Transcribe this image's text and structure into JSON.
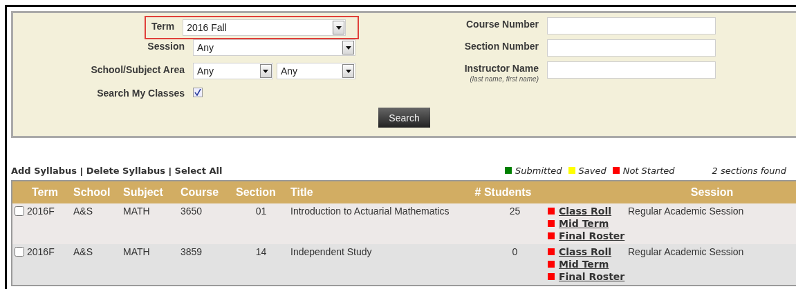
{
  "filters": {
    "term": {
      "label": "Term",
      "value": "2016 Fall",
      "highlighted": true
    },
    "session": {
      "label": "Session",
      "value": "Any"
    },
    "school_subject": {
      "label": "School/Subject Area",
      "values": [
        "Any",
        "Any"
      ]
    },
    "search_my_classes": {
      "label": "Search My Classes",
      "checked": true
    },
    "course_number": {
      "label": "Course Number"
    },
    "section_number": {
      "label": "Section Number"
    },
    "instructor_name": {
      "label": "Instructor Name",
      "hint": "(last name, first name)"
    },
    "search_button": "Search"
  },
  "actions": {
    "items": [
      "Add Syllabus",
      "Delete Syllabus",
      "Select All"
    ],
    "separator": "|"
  },
  "legend": [
    {
      "label": "Submitted",
      "color": "#008000"
    },
    {
      "label": "Saved",
      "color": "#ffff00"
    },
    {
      "label": "Not Started",
      "color": "#ff0000"
    }
  ],
  "result_count": "2 sections found",
  "table": {
    "columns": [
      "Term",
      "School",
      "Subject",
      "Course",
      "Section",
      "Title",
      "# Students",
      "Session"
    ],
    "rows": [
      {
        "checked": false,
        "term": "2016F",
        "school": "A&S",
        "subject": "MATH",
        "course": "3650",
        "section": "01",
        "title": "Introduction to Actuarial Mathematics",
        "students": "25",
        "reports": [
          {
            "label": "Class Roll",
            "color": "#ff0000"
          },
          {
            "label": "Mid Term",
            "color": "#ff0000"
          },
          {
            "label": "Final Roster",
            "color": "#ff0000"
          }
        ],
        "session": "Regular Academic Session"
      },
      {
        "checked": false,
        "term": "2016F",
        "school": "A&S",
        "subject": "MATH",
        "course": "3859",
        "section": "14",
        "title": "Independent Study",
        "students": "0",
        "reports": [
          {
            "label": "Class Roll",
            "color": "#ff0000"
          },
          {
            "label": "Mid Term",
            "color": "#ff0000"
          },
          {
            "label": "Final Roster",
            "color": "#ff0000"
          }
        ],
        "session": "Regular Academic Session"
      }
    ]
  }
}
